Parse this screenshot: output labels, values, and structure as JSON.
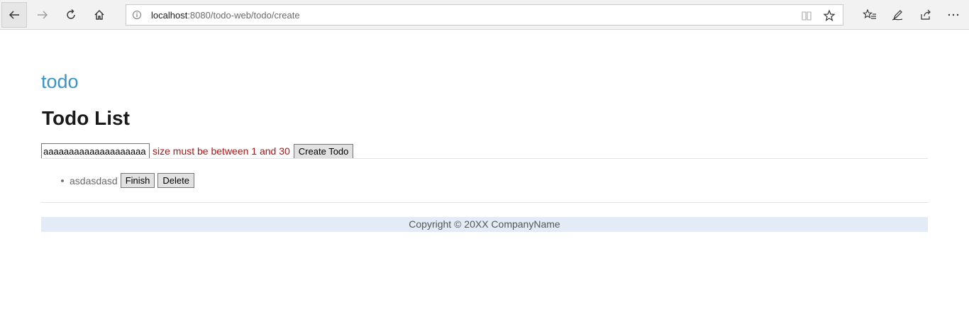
{
  "browser": {
    "url_host": "localhost",
    "url_rest": ":8080/todo-web/todo/create",
    "icons": {
      "back": "back-arrow-icon",
      "forward": "forward-arrow-icon",
      "reload": "reload-icon",
      "home": "home-icon",
      "site_info": "info-icon",
      "reading_view": "reading-view-icon",
      "favorite": "star-icon",
      "favorites": "favorites-list-icon",
      "notes": "pen-icon",
      "share": "share-icon",
      "more": "more-dots-icon"
    }
  },
  "page": {
    "brand": "todo",
    "title": "Todo List",
    "form": {
      "input_value": "aaaaaaaaaaaaaaaaaaaa",
      "error": "size must be between 1 and 30",
      "create_label": "Create Todo"
    },
    "todos": [
      {
        "text": "asdasdasd",
        "finish_label": "Finish",
        "delete_label": "Delete"
      }
    ],
    "footer": "Copyright © 20XX CompanyName"
  },
  "colors": {
    "brand": "#3b93c8",
    "error": "#b31212",
    "footer_bg": "#e3ebf7"
  }
}
